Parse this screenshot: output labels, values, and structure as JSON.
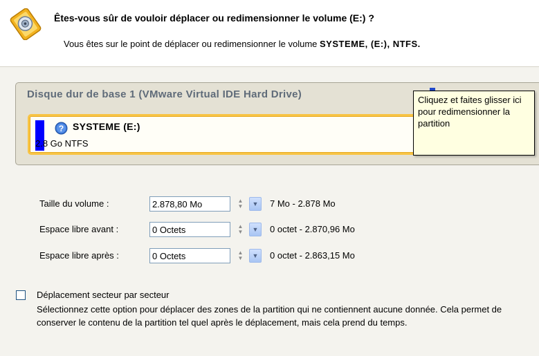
{
  "header": {
    "title": "Êtes-vous sûr de vouloir déplacer ou redimensionner le volume (E:) ?",
    "subtitle_prefix": "Vous êtes sur le point de déplacer ou redimensionner le volume ",
    "subtitle_volume": "SYSTEME, (E:), NTFS.",
    "icon": "disk-warning-icon"
  },
  "disk": {
    "title": "Disque dur de base 1 (VMware Virtual IDE Hard Drive)",
    "partition": {
      "name": "SYSTEME (E:)",
      "size": "2.8 Go NTFS",
      "color": "#0000ff",
      "icon": "help-icon",
      "handle_icon": "resize-handle-icon"
    }
  },
  "tooltip": {
    "text": "Cliquez et faites glisser ici pour redimensionner la partition"
  },
  "form": {
    "rows": [
      {
        "label": "Taille du volume :",
        "value": "2.878,80 Mo",
        "range": "7 Mo - 2.878 Mo"
      },
      {
        "label": "Espace libre avant :",
        "value": "0 Octets",
        "range": "0 octet - 2.870,96 Mo"
      },
      {
        "label": "Espace libre après :",
        "value": "0 Octets",
        "range": "0 octet - 2.863,15 Mo"
      }
    ]
  },
  "option": {
    "label": "Déplacement secteur par secteur",
    "checked": false,
    "description": "Sélectionnez cette option pour déplacer des zones de la partition qui ne contiennent aucune donnée. Cela permet de conserver le contenu de la partition tel quel après le déplacement, mais cela prend du temps."
  }
}
